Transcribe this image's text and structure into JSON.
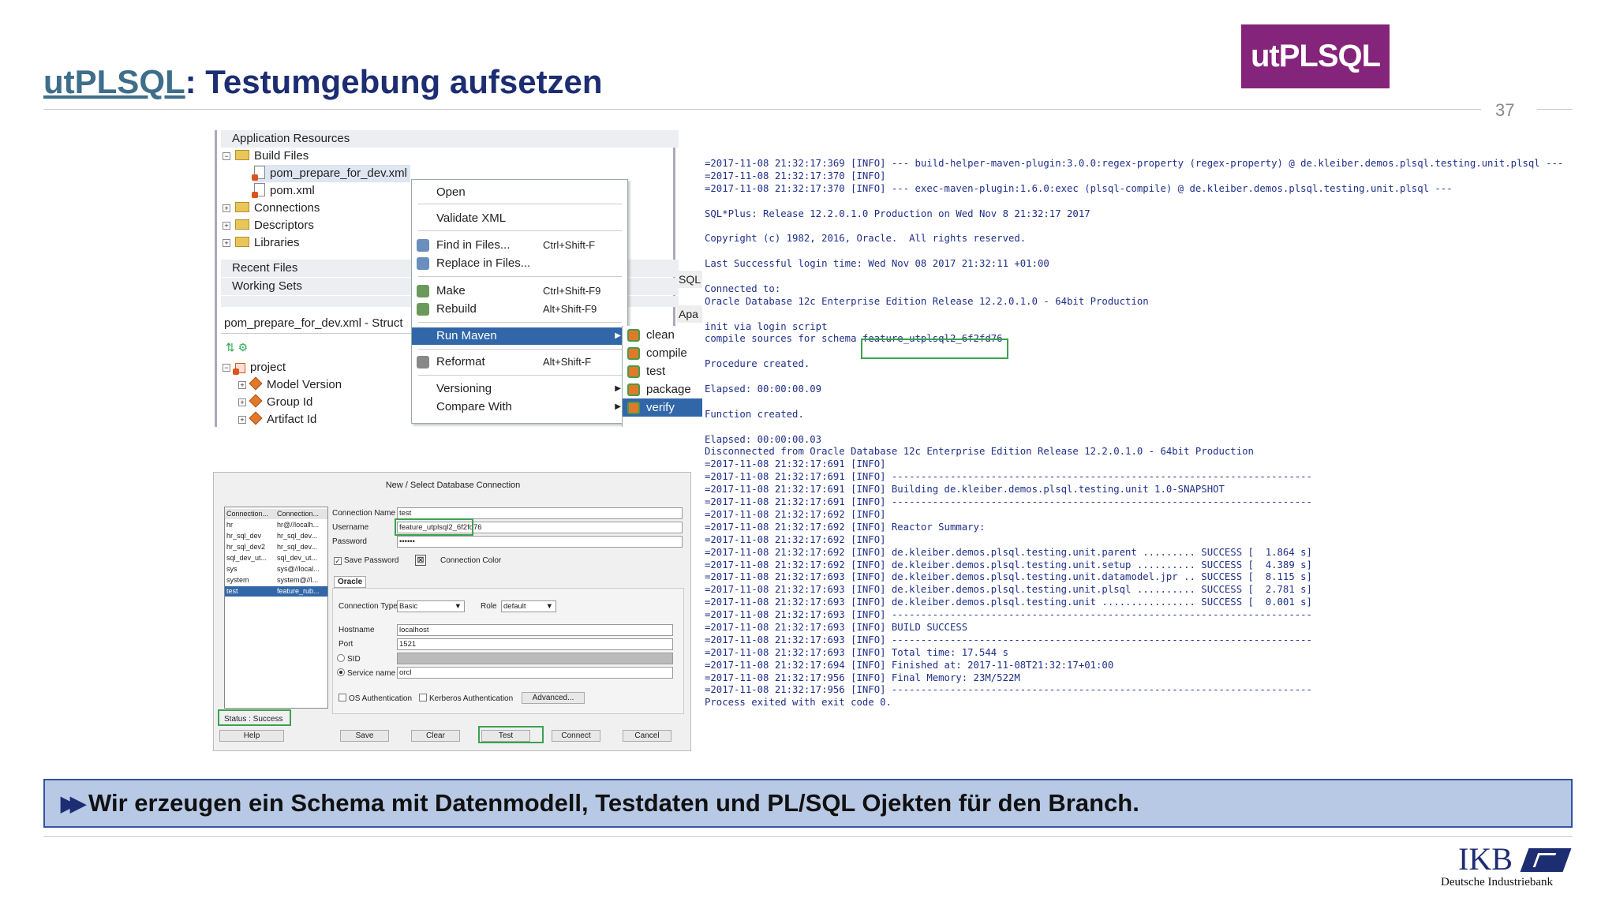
{
  "slide": {
    "title_link": "utPLSQL",
    "title_rest": ": Testumgebung aufsetzen",
    "logo_text": "utPLSQL",
    "page_number": "37",
    "banner_text": "Wir erzeugen ein Schema mit Datenmodell, Testdaten und PL/SQL Ojekten für den Branch.",
    "footer_logo": "IKB",
    "footer_sub": "Deutsche Industriebank"
  },
  "ide": {
    "app_resources": "Application Resources",
    "build_files": "Build Files",
    "file_selected": "pom_prepare_for_dev.xml",
    "file2": "pom.xml",
    "connections": "Connections",
    "descriptors": "Descriptors",
    "libraries": "Libraries",
    "recent_files": "Recent Files",
    "working_sets": "Working Sets",
    "structure_title": "pom_prepare_for_dev.xml - Struct",
    "project": "project",
    "model_version": "Model Version",
    "group_id": "Group Id",
    "artifact_id": "Artifact Id",
    "sql_tab": "SQL",
    "apa_tab": "Apa"
  },
  "menu": {
    "open": "Open",
    "validate_xml": "Validate XML",
    "find_in_files": "Find in Files...",
    "find_sc": "Ctrl+Shift-F",
    "replace_in_files": "Replace in Files...",
    "make": "Make",
    "make_sc": "Ctrl+Shift-F9",
    "rebuild": "Rebuild",
    "rebuild_sc": "Alt+Shift-F9",
    "run_maven": "Run Maven",
    "reformat": "Reformat",
    "reformat_sc": "Alt+Shift-F",
    "versioning": "Versioning",
    "compare_with": "Compare With",
    "sub_clean": "clean",
    "sub_compile": "compile",
    "sub_test": "test",
    "sub_package": "package",
    "sub_verify": "verify"
  },
  "console": {
    "lines": [
      "=2017-11-08 21:32:17:369 [INFO] --- build-helper-maven-plugin:3.0.0:regex-property (regex-property) @ de.kleiber.demos.plsql.testing.unit.plsql ---",
      "=2017-11-08 21:32:17:370 [INFO]",
      "=2017-11-08 21:32:17:370 [INFO] --- exec-maven-plugin:1.6.0:exec (plsql-compile) @ de.kleiber.demos.plsql.testing.unit.plsql ---",
      "",
      "SQL*Plus: Release 12.2.0.1.0 Production on Wed Nov 8 21:32:17 2017",
      "",
      "Copyright (c) 1982, 2016, Oracle.  All rights reserved.",
      "",
      "Last Successful login time: Wed Nov 08 2017 21:32:11 +01:00",
      "",
      "Connected to:",
      "Oracle Database 12c Enterprise Edition Release 12.2.0.1.0 - 64bit Production",
      "",
      "init via login script",
      "compile sources for schema feature_utplsql2_6f2fd76",
      "",
      "Procedure created.",
      "",
      "Elapsed: 00:00:00.09",
      "",
      "Function created.",
      "",
      "Elapsed: 00:00:00.03",
      "Disconnected from Oracle Database 12c Enterprise Edition Release 12.2.0.1.0 - 64bit Production",
      "=2017-11-08 21:32:17:691 [INFO]",
      "=2017-11-08 21:32:17:691 [INFO] ------------------------------------------------------------------------",
      "=2017-11-08 21:32:17:691 [INFO] Building de.kleiber.demos.plsql.testing.unit 1.0-SNAPSHOT",
      "=2017-11-08 21:32:17:691 [INFO] ------------------------------------------------------------------------",
      "=2017-11-08 21:32:17:692 [INFO]",
      "=2017-11-08 21:32:17:692 [INFO] Reactor Summary:",
      "=2017-11-08 21:32:17:692 [INFO]",
      "=2017-11-08 21:32:17:692 [INFO] de.kleiber.demos.plsql.testing.unit.parent ......... SUCCESS [  1.864 s]",
      "=2017-11-08 21:32:17:692 [INFO] de.kleiber.demos.plsql.testing.unit.setup .......... SUCCESS [  4.389 s]",
      "=2017-11-08 21:32:17:693 [INFO] de.kleiber.demos.plsql.testing.unit.datamodel.jpr .. SUCCESS [  8.115 s]",
      "=2017-11-08 21:32:17:693 [INFO] de.kleiber.demos.plsql.testing.unit.plsql .......... SUCCESS [  2.781 s]",
      "=2017-11-08 21:32:17:693 [INFO] de.kleiber.demos.plsql.testing.unit ................ SUCCESS [  0.001 s]",
      "=2017-11-08 21:32:17:693 [INFO] ------------------------------------------------------------------------",
      "=2017-11-08 21:32:17:693 [INFO] BUILD SUCCESS",
      "=2017-11-08 21:32:17:693 [INFO] ------------------------------------------------------------------------",
      "=2017-11-08 21:32:17:693 [INFO] Total time: 17.544 s",
      "=2017-11-08 21:32:17:694 [INFO] Finished at: 2017-11-08T21:32:17+01:00",
      "=2017-11-08 21:32:17:956 [INFO] Final Memory: 23M/522M",
      "=2017-11-08 21:32:17:956 [INFO] ------------------------------------------------------------------------",
      "Process exited with exit code 0."
    ]
  },
  "dialog": {
    "title": "New / Select Database Connection",
    "list_col1": "Connection...",
    "list_col2": "Connection...",
    "connections": [
      {
        "name": "hr",
        "details": "hr@//localh..."
      },
      {
        "name": "hr_sql_dev",
        "details": "hr_sql_dev..."
      },
      {
        "name": "hr_sql_dev2",
        "details": "hr_sql_dev..."
      },
      {
        "name": "sql_dev_ut...",
        "details": "sql_dev_ut..."
      },
      {
        "name": "sys",
        "details": "sys@//local..."
      },
      {
        "name": "system",
        "details": "system@//l..."
      },
      {
        "name": "test",
        "details": "feature_rub..."
      }
    ],
    "conn_name_label": "Connection Name",
    "conn_name_value": "test",
    "username_label": "Username",
    "username_value": "feature_utplsql2_6f2fd76",
    "password_label": "Password",
    "password_value": "••••••",
    "save_password": "Save Password",
    "connection_color": "Connection Color",
    "oracle_tab": "Oracle",
    "conn_type_label": "Connection Type",
    "conn_type_value": "Basic",
    "role_label": "Role",
    "role_value": "default",
    "hostname_label": "Hostname",
    "hostname_value": "localhost",
    "port_label": "Port",
    "port_value": "1521",
    "sid_label": "SID",
    "service_label": "Service name",
    "service_value": "orcl",
    "os_auth": "OS Authentication",
    "kerberos_auth": "Kerberos Authentication",
    "advanced": "Advanced...",
    "status": "Status : Success",
    "help": "Help",
    "save": "Save",
    "clear": "Clear",
    "test": "Test",
    "connect": "Connect",
    "cancel": "Cancel"
  }
}
